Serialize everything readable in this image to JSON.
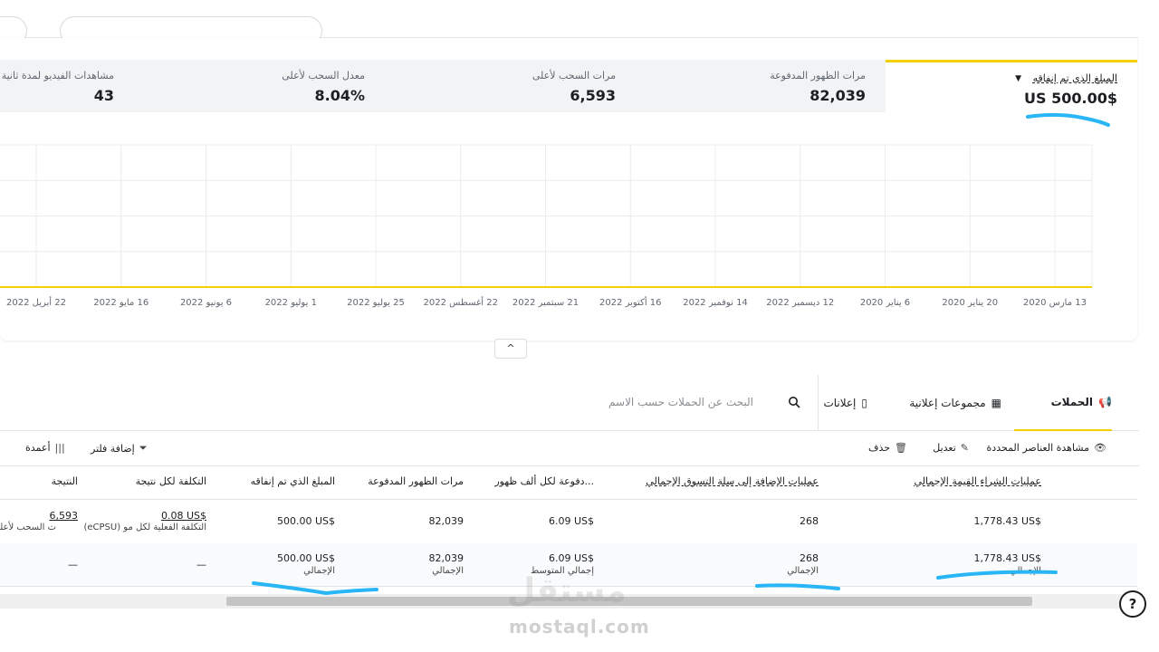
{
  "metrics": [
    {
      "label": "المبلغ الذي تم إنفاقه",
      "value": "$US 500.00",
      "selected": true
    },
    {
      "label": "مرات الظهور المدفوعة",
      "value": "82,039"
    },
    {
      "label": "مرات السحب لأعلى",
      "value": "6,593"
    },
    {
      "label": "معدل السحب لأعلى",
      "value": "8.04%"
    },
    {
      "label": "مشاهدات الفيديو لمدة ثانية",
      "value": "43"
    }
  ],
  "chart_data": {
    "type": "line",
    "x_ticks": [
      "13 مارس 2020",
      "20 يناير 2020",
      "6 يناير 2020",
      "12 ديسمبر 2022",
      "14 نوفمبر 2022",
      "16 أكتوبر 2022",
      "21 سبتمبر 2022",
      "22 أغسطس 2022",
      "25 يوليو 2022",
      "1 يوليو 2022",
      "6 يونيو 2022",
      "16 مايو 2022",
      "22 أبريل 2022"
    ],
    "series_color": "#f5d000",
    "grid": true
  },
  "tabs": [
    {
      "label": "الحملات",
      "icon": "megaphone-icon",
      "active": true
    },
    {
      "label": "مجموعات إعلانية",
      "icon": "grid-icon"
    },
    {
      "label": "إعلانات",
      "icon": "phone-icon"
    }
  ],
  "search": {
    "placeholder": "البحث عن الحملات حسب الاسم"
  },
  "toolbar": {
    "view_selected": "مشاهدة العناصر المحددة",
    "edit": "تعديل",
    "delete": "حذف",
    "add_filter": "إضافة فلتر",
    "columns": "أعمدة"
  },
  "table": {
    "headers": {
      "purchase_value": "عمليات الشراء القيمة الإجمالي",
      "add_to_cart": "عمليات الإضافة إلى سلة التسوق الإجمالي",
      "cpm": "...دفوعة لكل ألف ظهور",
      "impressions": "مرات الظهور المدفوعة",
      "spend": "المبلغ الذي تم إنفاقه",
      "cost_per_result": "التكلفة لكل نتيجة",
      "result": "النتيجة"
    },
    "row": {
      "purchase_value": "1,778.43 US$",
      "add_to_cart": "268",
      "cpm": "6.09 US$",
      "impressions": "82,039",
      "spend": "500.00 US$",
      "cost_per_result": "0.08 US$",
      "cost_per_result_sub": "التكلفة الفعلية لكل مو (eCPSU)",
      "result": "6,593",
      "result_sub": "ت السحب لأعلى"
    },
    "totals": {
      "purchase_value": "1,778.43 US$",
      "purchase_value_sub": "الإجمالي",
      "add_to_cart": "268",
      "add_to_cart_sub": "الإجمالي",
      "cpm": "6.09 US$",
      "cpm_sub": "إجمالي المتوسط",
      "impressions": "82,039",
      "impressions_sub": "الإجمالي",
      "spend": "500.00 US$",
      "spend_sub": "الإجمالي",
      "cost_per_result": "—",
      "result": "—"
    }
  },
  "watermark": {
    "logo": "مستقل",
    "url": "mostaql.com"
  },
  "help": {
    "label": "?"
  },
  "collapse": {
    "label": "^"
  },
  "highlight_color": "#29b6f6"
}
